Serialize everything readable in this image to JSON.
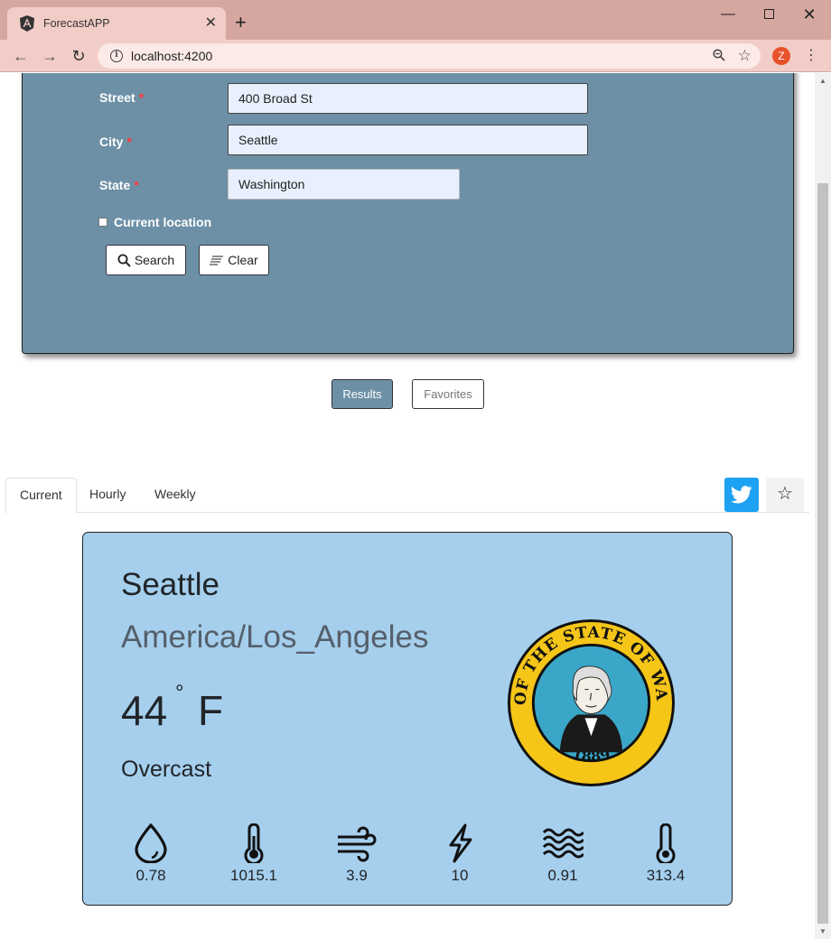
{
  "browser": {
    "tab_title": "ForecastAPP",
    "tab_close": "✕",
    "new_tab": "+",
    "url": "localhost:4200",
    "profile_initial": "Z",
    "win_minimize": "—",
    "win_close": "✕"
  },
  "form": {
    "street_label": "Street",
    "street_value": "400 Broad St",
    "city_label": "City",
    "city_value": "Seattle",
    "state_label": "State",
    "state_value": "Washington",
    "required_mark": "*",
    "current_location_label": "Current location",
    "current_location_checked": false,
    "search_label": "Search",
    "clear_label": "Clear"
  },
  "view_toggle": {
    "results_label": "Results",
    "favorites_label": "Favorites",
    "active": "Results"
  },
  "result_tabs": {
    "items": [
      "Current",
      "Hourly",
      "Weekly"
    ],
    "active": "Current"
  },
  "current": {
    "city": "Seattle",
    "timezone": "America/Los_Angeles",
    "temperature": "44",
    "degree_symbol": "°",
    "unit": "F",
    "summary": "Overcast",
    "seal_text_top": "THE SEAL OF THE STATE OF WASHINGTON",
    "seal_year": "1889",
    "stats": [
      {
        "icon": "humidity-icon",
        "value": "0.78"
      },
      {
        "icon": "pressure-icon",
        "value": "1015.1"
      },
      {
        "icon": "wind-speed-icon",
        "value": "3.9"
      },
      {
        "icon": "visibility-icon",
        "value": "10"
      },
      {
        "icon": "cloud-cover-icon",
        "value": "0.91"
      },
      {
        "icon": "ozone-icon",
        "value": "313.4"
      }
    ]
  },
  "colors": {
    "panel": "#6d90a6",
    "card": "#a5cfed",
    "twitter": "#1da1f2",
    "seal_gold": "#f5c518",
    "seal_blue": "#3aa7c9"
  }
}
